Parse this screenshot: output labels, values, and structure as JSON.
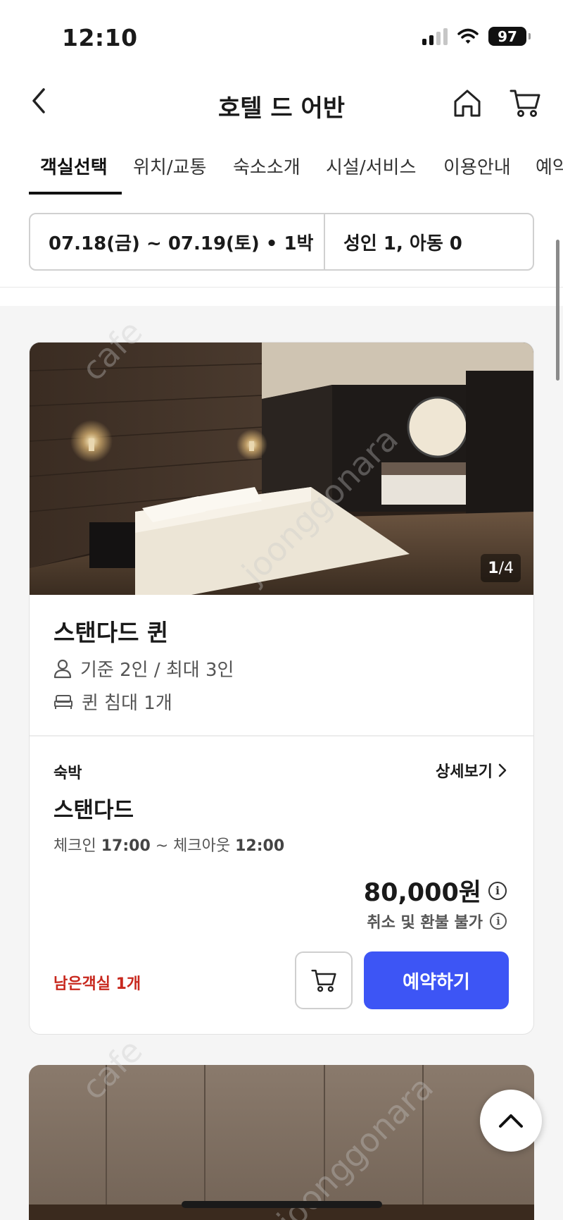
{
  "status_bar": {
    "time": "12:10",
    "battery": "97"
  },
  "nav": {
    "title": "호텔 드 어반"
  },
  "tabs": [
    {
      "label": "객실선택"
    },
    {
      "label": "위치/교통"
    },
    {
      "label": "숙소소개"
    },
    {
      "label": "시설/서비스"
    },
    {
      "label": "이용안내"
    },
    {
      "label": "예약"
    }
  ],
  "filter": {
    "dates": "07.18(금) ~ 07.19(토) • 1박",
    "guests": "성인 1, 아동 0"
  },
  "rooms": [
    {
      "photo_counter_current": "1",
      "photo_counter_total": "/4",
      "name": "스탠다드 퀸",
      "capacity": "기준 2인 / 최대 3인",
      "bed": "퀸 침대 1개",
      "rate_type": "숙박",
      "detail_link": "상세보기",
      "rate_name": "스탠다드",
      "checkin_label": "체크인 ",
      "checkin_time": "17:00",
      "checkout_label": " ~ 체크아웃 ",
      "checkout_time": "12:00",
      "price": "80,000원",
      "refund_policy": "취소 및 환불 불가",
      "remaining": "남은객실 1개",
      "book_label": "예약하기"
    }
  ],
  "watermark": {
    "text1": "cafe",
    "text2": "joonggonara"
  },
  "colors": {
    "accent": "#3d55f5",
    "remaining": "#c8281e"
  },
  "icons": [
    "back-icon",
    "home-icon",
    "cart-icon",
    "person-icon",
    "bed-icon",
    "chevron-right-icon",
    "info-icon",
    "chevron-up-icon"
  ]
}
